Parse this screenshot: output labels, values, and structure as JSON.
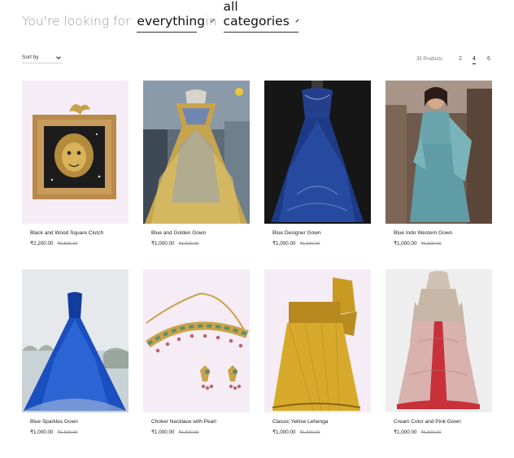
{
  "filters": {
    "prefix": "You're looking for",
    "search_value": "everything",
    "joiner": "in",
    "category_value": "all categories"
  },
  "toolbar": {
    "sort_label": "Sort by",
    "products_count": "35 Products",
    "pages": [
      "2",
      "4",
      "6"
    ],
    "active_page": "4"
  },
  "products": [
    {
      "name": "Black and Wood Square Clutch",
      "price": "₹2,200.00",
      "old_price": "₹2,500.00"
    },
    {
      "name": "Blue and Golden Gown",
      "price": "₹1,000.00",
      "old_price": "₹1,500.00"
    },
    {
      "name": "Blue Designer Gown",
      "price": "₹1,000.00",
      "old_price": "₹1,500.00"
    },
    {
      "name": "Blue Indo Western Gown",
      "price": "₹1,000.00",
      "old_price": "₹1,500.00"
    },
    {
      "name": "Blue Sparkles Gown",
      "price": "₹1,000.00",
      "old_price": "₹1,500.00"
    },
    {
      "name": "Choker Necklace with Pearl",
      "price": "₹1,000.00",
      "old_price": "₹1,500.00"
    },
    {
      "name": "Classic Yellow Lehenga",
      "price": "₹1,000.00",
      "old_price": "₹1,500.00"
    },
    {
      "name": "Cream Color and Pink Gown",
      "price": "₹1,000.00",
      "old_price": "₹1,500.00"
    }
  ],
  "colors": {
    "accent_text": "#111111",
    "muted_text": "#9a9a9a",
    "image_placeholder_pink": "#f6ecf6",
    "image_placeholder_grey": "#eeeeee"
  }
}
